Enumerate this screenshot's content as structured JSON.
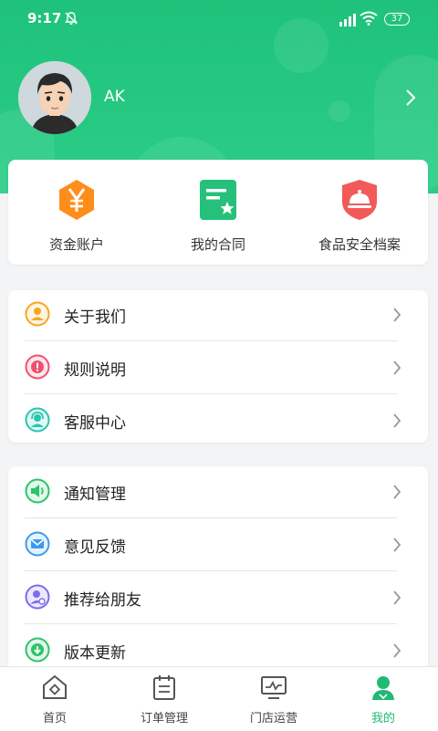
{
  "status_bar": {
    "time": "9:17",
    "battery": "37"
  },
  "profile": {
    "name": "AK"
  },
  "quick_actions": [
    {
      "label": "资金账户",
      "icon": "yen-icon"
    },
    {
      "label": "我的合同",
      "icon": "contract-icon"
    },
    {
      "label": "食品安全档案",
      "icon": "food-safety-icon"
    }
  ],
  "menu_group_1": [
    {
      "label": "关于我们",
      "icon": "about-icon"
    },
    {
      "label": "规则说明",
      "icon": "rules-icon"
    },
    {
      "label": "客服中心",
      "icon": "customer-service-icon"
    }
  ],
  "menu_group_2": [
    {
      "label": "通知管理",
      "icon": "notification-icon"
    },
    {
      "label": "意见反馈",
      "icon": "feedback-icon"
    },
    {
      "label": "推荐给朋友",
      "icon": "recommend-icon"
    },
    {
      "label": "版本更新",
      "icon": "update-icon"
    }
  ],
  "tabs": [
    {
      "label": "首页",
      "icon": "home-icon"
    },
    {
      "label": "订单管理",
      "icon": "orders-icon"
    },
    {
      "label": "门店运营",
      "icon": "store-icon"
    },
    {
      "label": "我的",
      "icon": "profile-icon"
    }
  ],
  "colors": {
    "brand_green": "#1fc27a",
    "active_tab": "#1fba74"
  }
}
